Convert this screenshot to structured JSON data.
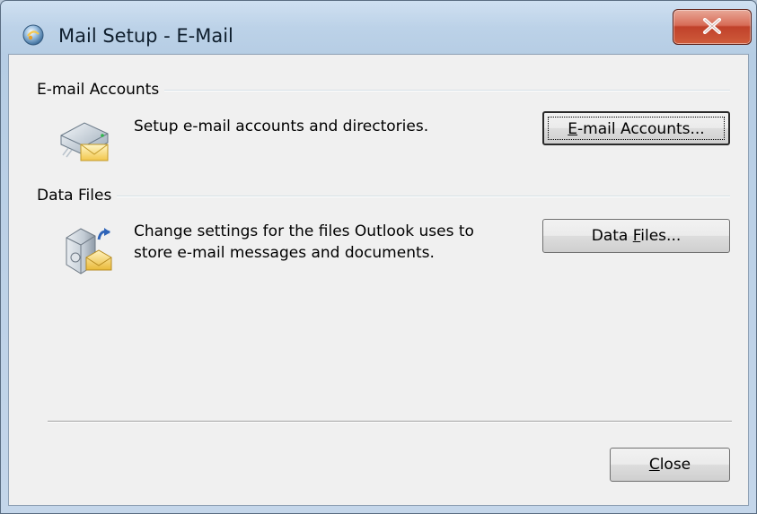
{
  "window": {
    "title": "Mail Setup - E-Mail",
    "close_icon": "close-x-icon"
  },
  "email_accounts": {
    "group_label": "E-mail Accounts",
    "description": "Setup e-mail accounts and directories.",
    "button": {
      "accel": "E",
      "rest": "-mail Accounts..."
    },
    "icon": "email-accounts-icon"
  },
  "data_files": {
    "group_label": "Data Files",
    "description_line1": "Change settings for the files Outlook uses to",
    "description_line2": "store e-mail messages and documents.",
    "button": {
      "pre": "Data ",
      "accel": "F",
      "rest": "iles..."
    },
    "icon": "data-files-icon"
  },
  "footer": {
    "close_button": {
      "accel": "C",
      "rest": "lose"
    }
  },
  "colors": {
    "titlebar": "#bcd2e8",
    "close_button": "#c0412a",
    "client_bg": "#f0f0f0"
  }
}
